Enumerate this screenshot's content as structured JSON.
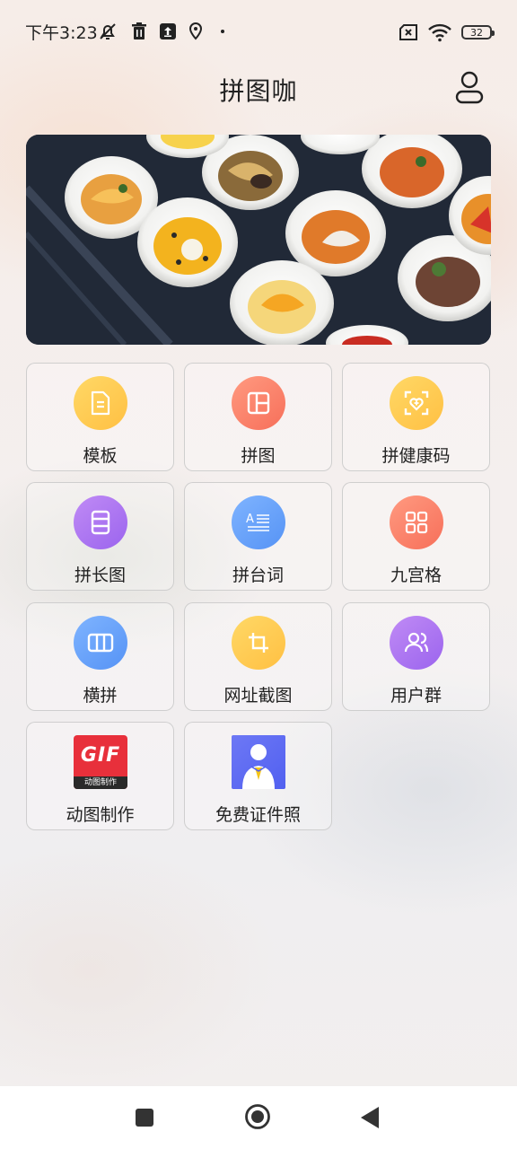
{
  "status_bar": {
    "time": "下午3:23",
    "battery": "32",
    "icons": [
      "notification-muted-icon",
      "trash-icon",
      "upload-icon",
      "location-icon",
      "dot-icon",
      "sim-off-icon",
      "wifi-icon",
      "battery-icon"
    ]
  },
  "header": {
    "title": "拼图咖",
    "user_icon": "user-icon"
  },
  "banner": {
    "image": "food-bowls-photo"
  },
  "features": [
    {
      "label": "模板",
      "icon": "document-icon",
      "color": "#ffc043"
    },
    {
      "label": "拼图",
      "icon": "layout-icon",
      "color": "#f76f5a"
    },
    {
      "label": "拼健康码",
      "icon": "health-code-icon",
      "color": "#ffc043"
    },
    {
      "label": "拼长图",
      "icon": "long-image-icon",
      "color": "#9b64ee"
    },
    {
      "label": "拼台词",
      "icon": "subtitle-icon",
      "color": "#5693f5"
    },
    {
      "label": "九宫格",
      "icon": "grid-icon",
      "color": "#f76f5a"
    },
    {
      "label": "横拼",
      "icon": "horizontal-columns-icon",
      "color": "#5693f5"
    },
    {
      "label": "网址截图",
      "icon": "crop-icon",
      "color": "#ffc043"
    },
    {
      "label": "用户群",
      "icon": "users-icon",
      "color": "#9b64ee"
    },
    {
      "label": "动图制作",
      "icon": "gif-maker-icon",
      "color": "#e8303b",
      "badge_text": "GIF",
      "badge_sub": "动图制作"
    },
    {
      "label": "免费证件照",
      "icon": "id-photo-icon",
      "color": "#5160f0"
    }
  ],
  "nav_bar": {
    "buttons": [
      "recent-apps",
      "home",
      "back"
    ]
  }
}
